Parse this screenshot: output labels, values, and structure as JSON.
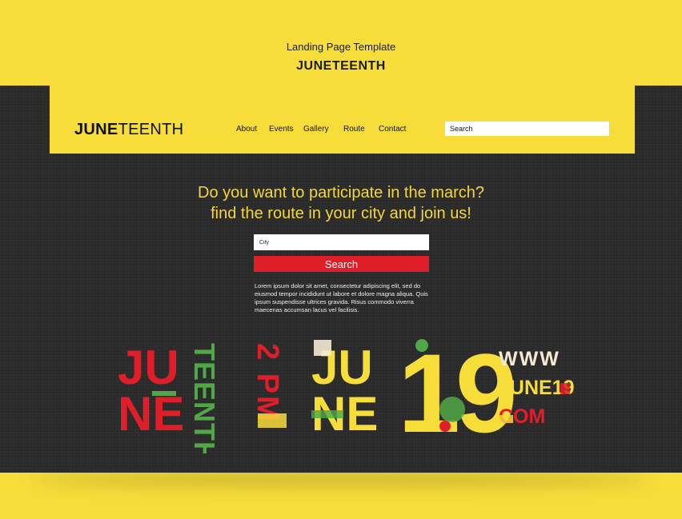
{
  "caption": {
    "subtitle": "Landing Page Template",
    "title": "JUNETEENTH"
  },
  "header": {
    "logo_bold": "JUNE",
    "logo_rest": "TEENTH",
    "nav": [
      {
        "label": "About"
      },
      {
        "label": "Events"
      },
      {
        "label": "Gallery"
      },
      {
        "label": "Route"
      },
      {
        "label": "Contact"
      }
    ],
    "search_placeholder": "Search"
  },
  "hero": {
    "headline_line1": "Do you want to participate in the march?",
    "headline_line2": "find the route in your city and join us!",
    "city_placeholder": "City",
    "search_button": "Search",
    "body": "Lorem ipsum dolor sit amet, consectetur adipiscing elit, sed do eiusmod tempor incididunt ut labore et dolore magna aliqua. Quis ipsum suspendisse ultrices gravida. Risus commodo viverra maecenas accumsan lacus vel facilisis."
  },
  "artwork": {
    "block1_top": "JU",
    "block1_bottom": "NE",
    "teenth_vertical": "TEENTH",
    "time_vertical": "2 PM",
    "block2_top": "JU",
    "block2_bottom": "NE",
    "day": "19",
    "web_line1": "WWW",
    "web_line2": "JUNE19",
    "web_line3": "COM"
  },
  "colors": {
    "yellow": "#f7dd3a",
    "dark": "#2c2c2c",
    "red": "#e01e2a",
    "green": "#4fa845",
    "cream": "#f3ead3"
  }
}
